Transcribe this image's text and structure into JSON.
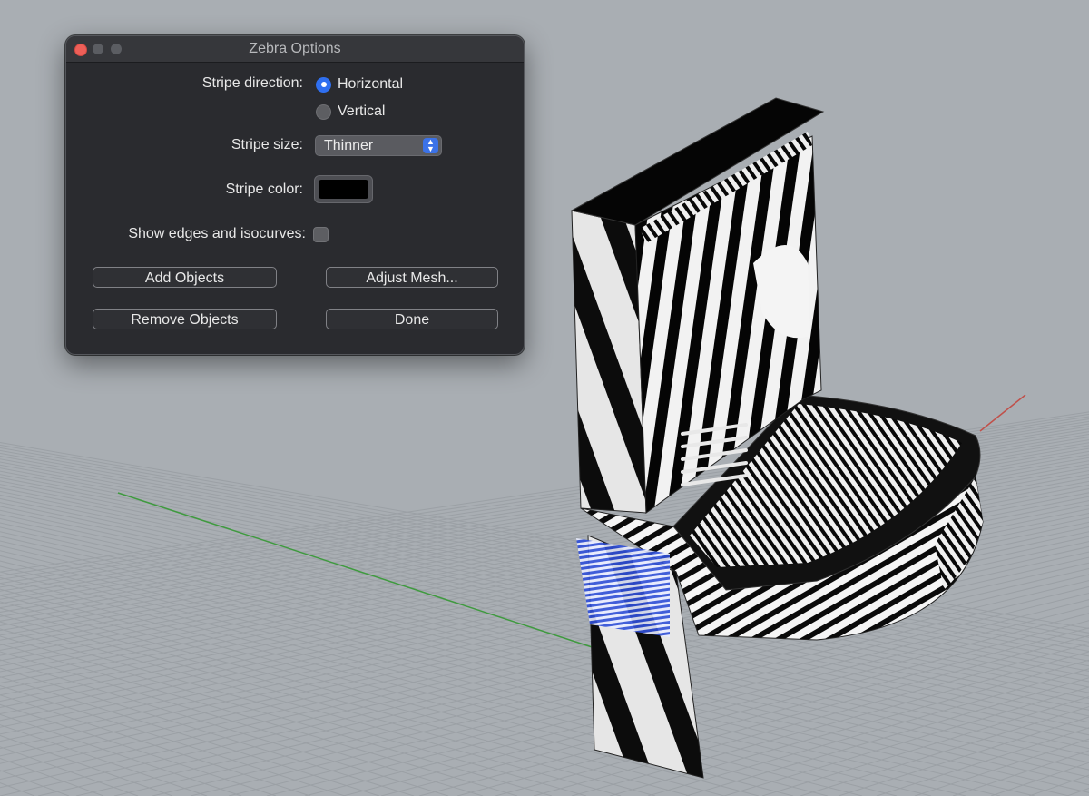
{
  "dialog": {
    "title": "Zebra Options",
    "stripe_direction": {
      "label": "Stripe direction:",
      "options": [
        {
          "label": "Horizontal",
          "selected": true
        },
        {
          "label": "Vertical",
          "selected": false
        }
      ]
    },
    "stripe_size": {
      "label": "Stripe size:",
      "value": "Thinner"
    },
    "stripe_color": {
      "label": "Stripe color:",
      "color": "#000000"
    },
    "show_edges": {
      "label": "Show edges and isocurves:",
      "checked": false
    },
    "buttons": {
      "add_objects": "Add Objects",
      "adjust_mesh": "Adjust Mesh...",
      "remove_objects": "Remove Objects",
      "done": "Done"
    }
  },
  "viewport": {
    "background_color": "#a9aeb3",
    "grid_color": "#9ba0a5",
    "x_axis_color": "#c0504a",
    "y_axis_color": "#3f9a3f",
    "object_colors": [
      "#000000",
      "#ffffff"
    ],
    "selection_color": "#2f4fd8"
  }
}
